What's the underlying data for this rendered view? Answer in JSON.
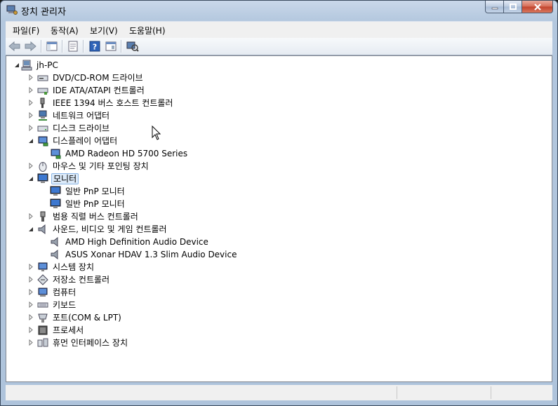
{
  "window": {
    "title": "장치 관리자"
  },
  "menu": [
    {
      "label": "파일(F)"
    },
    {
      "label": "동작(A)"
    },
    {
      "label": "보기(V)"
    },
    {
      "label": "도움말(H)"
    }
  ],
  "toolbar": {
    "buttons": [
      "back-icon",
      "forward-icon",
      "console-tree-icon",
      "properties-icon",
      "help-icon",
      "view-icon",
      "scan-hardware-icon"
    ]
  },
  "tree": {
    "root": {
      "label": "jh-PC",
      "icon": "computer-icon"
    },
    "nodes": [
      {
        "label": "DVD/CD-ROM 드라이브",
        "icon": "optical-drive-icon",
        "level": 1,
        "expander": "collapsed"
      },
      {
        "label": "IDE ATA/ATAPI 컨트롤러",
        "icon": "ide-controller-icon",
        "level": 1,
        "expander": "collapsed"
      },
      {
        "label": "IEEE 1394 버스 호스트 컨트롤러",
        "icon": "ieee1394-icon",
        "level": 1,
        "expander": "collapsed"
      },
      {
        "label": "네트워크 어댑터",
        "icon": "network-adapter-icon",
        "level": 1,
        "expander": "collapsed"
      },
      {
        "label": "디스크 드라이브",
        "icon": "disk-drive-icon",
        "level": 1,
        "expander": "collapsed"
      },
      {
        "label": "디스플레이 어댑터",
        "icon": "display-adapter-icon",
        "level": 1,
        "expander": "expanded"
      },
      {
        "label": "AMD Radeon HD 5700 Series",
        "icon": "display-adapter-icon",
        "level": 2,
        "expander": "none"
      },
      {
        "label": "마우스 및 기타 포인팅 장치",
        "icon": "mouse-icon",
        "level": 1,
        "expander": "collapsed"
      },
      {
        "label": "모니터",
        "icon": "monitor-icon",
        "level": 1,
        "expander": "expanded",
        "selected": true
      },
      {
        "label": "일반 PnP 모니터",
        "icon": "monitor-icon",
        "level": 2,
        "expander": "none"
      },
      {
        "label": "일반 PnP 모니터",
        "icon": "monitor-icon",
        "level": 2,
        "expander": "none"
      },
      {
        "label": "범용 직렬 버스 컨트롤러",
        "icon": "usb-icon",
        "level": 1,
        "expander": "collapsed"
      },
      {
        "label": "사운드, 비디오 및 게임 컨트롤러",
        "icon": "speaker-icon",
        "level": 1,
        "expander": "expanded"
      },
      {
        "label": "AMD High Definition Audio Device",
        "icon": "speaker-icon",
        "level": 2,
        "expander": "none"
      },
      {
        "label": "ASUS Xonar HDAV 1.3 Slim Audio Device",
        "icon": "speaker-icon",
        "level": 2,
        "expander": "none"
      },
      {
        "label": "시스템 장치",
        "icon": "system-device-icon",
        "level": 1,
        "expander": "collapsed"
      },
      {
        "label": "저장소 컨트롤러",
        "icon": "storage-controller-icon",
        "level": 1,
        "expander": "collapsed"
      },
      {
        "label": "컴퓨터",
        "icon": "computer-node-icon",
        "level": 1,
        "expander": "collapsed"
      },
      {
        "label": "키보드",
        "icon": "keyboard-icon",
        "level": 1,
        "expander": "collapsed"
      },
      {
        "label": "포트(COM & LPT)",
        "icon": "port-icon",
        "level": 1,
        "expander": "collapsed"
      },
      {
        "label": "프로세서",
        "icon": "processor-icon",
        "level": 1,
        "expander": "collapsed"
      },
      {
        "label": "휴먼 인터페이스 장치",
        "icon": "hid-icon",
        "level": 1,
        "expander": "collapsed"
      }
    ]
  },
  "colors": {
    "selection": "#dceaf9",
    "selection_border": "#8cb7e6",
    "window_frame": "#b3c7de"
  }
}
